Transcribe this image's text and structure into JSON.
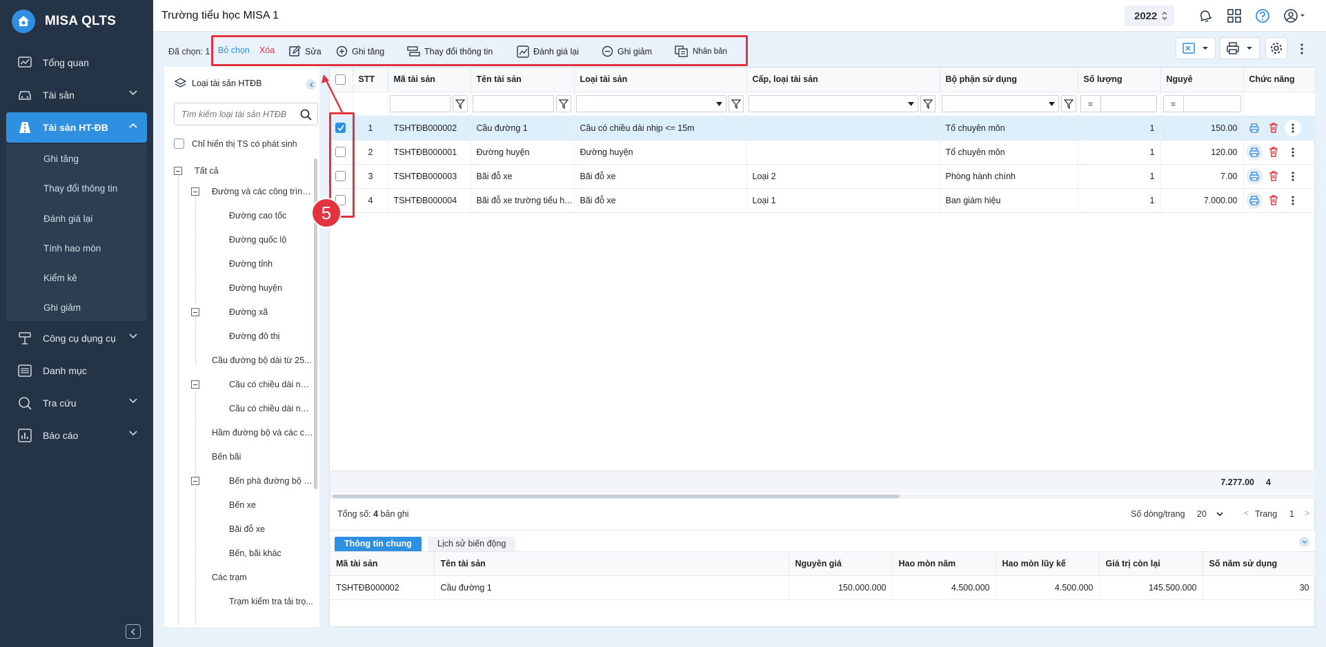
{
  "app": {
    "name": "MISA QLTS",
    "page_title": "Trường tiểu học MISA 1",
    "year": "2022"
  },
  "sidebar": {
    "items": [
      {
        "label": "Tổng quan",
        "icon": "chart-line-icon"
      },
      {
        "label": "Tài sản",
        "icon": "car-icon"
      },
      {
        "label": "Tài sản HT-ĐB",
        "icon": "road-icon"
      },
      {
        "label": "Công cụ dụng cụ",
        "icon": "tools-icon"
      },
      {
        "label": "Danh mục",
        "icon": "list-icon"
      },
      {
        "label": "Tra cứu",
        "icon": "search-icon"
      },
      {
        "label": "Báo cáo",
        "icon": "report-icon"
      }
    ],
    "submenu": [
      "Ghi tăng",
      "Thay đổi thông tin",
      "Đánh giá lại",
      "Tính hao mòn",
      "Kiểm kê",
      "Ghi giảm"
    ]
  },
  "toolbar": {
    "selected_label": "Đã chọn: 1",
    "deselect": "Bỏ chọn",
    "delete": "Xóa",
    "edit": "Sửa",
    "increase": "Ghi tăng",
    "change_info": "Thay đổi thông tin",
    "revalue": "Đánh giá lại",
    "decrease": "Ghi giảm",
    "duplicate": "Nhân bản"
  },
  "left_panel": {
    "title": "Loại tài sản HTĐB",
    "search_placeholder": "Tìm kiếm loại tài sản HTĐB",
    "only_ts_label": "Chỉ hiển thị TS có phát sinh",
    "tree": [
      "Tất cả",
      "Đường và các công trình ...",
      "Đường cao tốc",
      "Đường quốc lộ",
      "Đường tỉnh",
      "Đường huyện",
      "Đường xã",
      "Đường đô thị",
      "Cầu đường bộ dài từ 25...",
      "Cầu có chiều dài nhị...",
      "Cầu có chiều dài nhị...",
      "Hầm đường bộ và các cô...",
      "Bến bãi",
      "Bến phà đường bộ v...",
      "Bến xe",
      "Bãi đỗ xe",
      "Bến, bãi khác",
      "Các trạm",
      "Trạm kiểm tra tải trọ..."
    ]
  },
  "grid": {
    "columns": [
      "STT",
      "Mã tài sản",
      "Tên tài sản",
      "Loại tài sản",
      "Cấp, loại tài sản",
      "Bộ phận sử dụng",
      "Số lượng",
      "Nguyê",
      "Chức năng"
    ],
    "filter_eq": "=",
    "rows": [
      {
        "stt": "1",
        "code": "TSHTĐB000002",
        "name": "Cầu đường 1",
        "type": "Cầu có chiều dài nhịp <= 15m",
        "grade": "",
        "dept": "Tổ chuyên môn",
        "qty": "1",
        "price": "150.00"
      },
      {
        "stt": "2",
        "code": "TSHTĐB000001",
        "name": "Đường huyện",
        "type": "Đường huyện",
        "grade": "",
        "dept": "Tổ chuyên môn",
        "qty": "1",
        "price": "120.00"
      },
      {
        "stt": "3",
        "code": "TSHTĐB000003",
        "name": "Bãi đỗ xe",
        "type": "Bãi đỗ xe",
        "grade": "Loại 2",
        "dept": "Phòng hành chính",
        "qty": "1",
        "price": "7.00"
      },
      {
        "stt": "4",
        "code": "TSHTĐB000004",
        "name": "Bãi đỗ xe trường tiểu h...",
        "type": "Bãi đỗ xe",
        "grade": "Loại 1",
        "dept": "Ban giám hiệu",
        "qty": "1",
        "price": "7.000.00"
      }
    ],
    "total_qty": "4",
    "total_price": "7.277.00"
  },
  "pager": {
    "total_prefix": "Tổng số: ",
    "total_count": "4",
    "total_suffix": " bản ghi",
    "rows_per_page_label": "Số dòng/trang",
    "rows_per_page": "20",
    "prev_symbol": "<",
    "page_label": "Trang",
    "page": "1",
    "next_symbol": ">"
  },
  "detail": {
    "tabs": [
      "Thông tin chung",
      "Lịch sử biến động"
    ],
    "columns": [
      "Mã tài sản",
      "Tên tài sản",
      "Nguyên giá",
      "Hao mòn năm",
      "Hao mòn lũy kế",
      "Giá trị còn lại",
      "Số năm sử dụng"
    ],
    "row": [
      "TSHTĐB000002",
      "Cầu đường 1",
      "150.000.000",
      "4.500.000",
      "4.500.000",
      "145.500.000",
      "30"
    ]
  },
  "annotation": {
    "step": "5",
    "color": "#e2333f"
  },
  "colors": {
    "accent": "#2f8fe0",
    "sidebar": "#243446",
    "danger": "#e2333f"
  }
}
